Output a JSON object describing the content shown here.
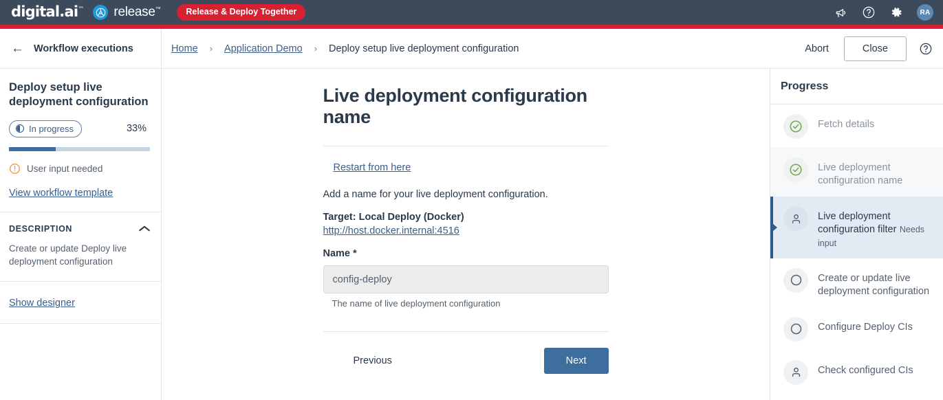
{
  "topbar": {
    "brand_primary": "digital.ai",
    "brand_primary_tm": "™",
    "brand_secondary": "release",
    "brand_secondary_tm": "™",
    "pill_label": "Release & Deploy Together",
    "icons": [
      {
        "name": "announcement-icon",
        "label": "announcement"
      },
      {
        "name": "help-icon",
        "label": "help"
      },
      {
        "name": "gear-icon",
        "label": "settings"
      }
    ],
    "avatar_initials": "RA",
    "bar_color": "#3c4a5c",
    "accent_red": "#d72030",
    "logo_blue": "#1b9ae0"
  },
  "header": {
    "back_label": "Workflow executions",
    "breadcrumb": [
      {
        "label": "Home",
        "link": true
      },
      {
        "label": "Application Demo",
        "link": true
      },
      {
        "label": "Deploy setup live deployment configuration",
        "link": false
      }
    ],
    "separator": "›",
    "abort_label": "Abort",
    "close_label": "Close",
    "help_icon": "help-icon"
  },
  "sidebar": {
    "title": "Deploy setup live deployment configuration",
    "status_badge": "In progress",
    "status_icon": "in-progress-icon",
    "percent_label": "33%",
    "percent_value": 33,
    "alert_icon": "alert-icon",
    "alert_text": "User input needed",
    "template_link": "View workflow template",
    "description_heading": "DESCRIPTION",
    "description_text": "Create or update Deploy live deployment configuration",
    "collapse_icon": "chevron-up-icon",
    "designer_link": "Show designer",
    "progress_fill_color": "#3f6f9f",
    "progress_track_color": "#c6d4e2",
    "alert_color": "#f2983e"
  },
  "main": {
    "title": "Live deployment configuration name",
    "restart_link": "Restart from here",
    "intro_text": "Add a name for your live deployment configuration.",
    "target_label": "Target: Local Deploy (Docker)",
    "target_url": "http://host.docker.internal:4516",
    "field_label": "Name *",
    "field_value": "config-deploy",
    "field_placeholder": "config-deploy",
    "field_hint": "The name of live deployment configuration",
    "previous_label": "Previous",
    "next_label": "Next",
    "next_color": "#3d6e9e"
  },
  "progress_panel": {
    "heading": "Progress",
    "items": [
      {
        "label": "Fetch details",
        "sub": "",
        "state": "done",
        "icon": "check-circle-icon"
      },
      {
        "label": "Live deployment configuration name",
        "sub": "",
        "state": "done-shaded",
        "icon": "check-circle-icon"
      },
      {
        "label": "Live deployment configuration filter",
        "sub": "Needs input",
        "state": "active",
        "icon": "person-icon"
      },
      {
        "label": "Create or update live deployment configuration",
        "sub": "",
        "state": "pending",
        "icon": "circle-icon"
      },
      {
        "label": "Configure Deploy CIs",
        "sub": "",
        "state": "pending",
        "icon": "circle-icon"
      },
      {
        "label": "Check configured CIs",
        "sub": "",
        "state": "pending",
        "icon": "person-icon"
      }
    ],
    "done_color": "#74a94f",
    "active_marker_color": "#2d5b8a"
  }
}
